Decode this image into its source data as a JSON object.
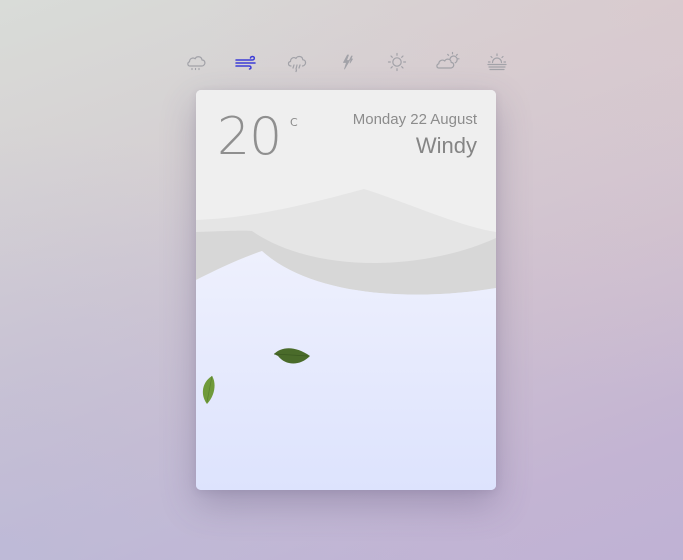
{
  "toolbar": {
    "icons": [
      {
        "name": "cloud-icon",
        "active": false
      },
      {
        "name": "wind-icon",
        "active": true
      },
      {
        "name": "rain-icon",
        "active": false
      },
      {
        "name": "thunder-icon",
        "active": false
      },
      {
        "name": "sun-icon",
        "active": false
      },
      {
        "name": "partly-cloudy-icon",
        "active": false
      },
      {
        "name": "haze-icon",
        "active": false
      }
    ],
    "active_color": "#3c3cd6",
    "inactive_color": "#a2a2a8"
  },
  "card": {
    "temperature": "20",
    "unit": "C",
    "date": "Monday 22 August",
    "condition": "Windy"
  },
  "colors": {
    "text": "#8c8c8c",
    "hill_light": "#efefef",
    "hill_mid": "#e4e4e4",
    "hill_dark": "#d6d6d6",
    "leaf_dark": "#4a6b2a",
    "leaf_light": "#6f9a3a"
  }
}
